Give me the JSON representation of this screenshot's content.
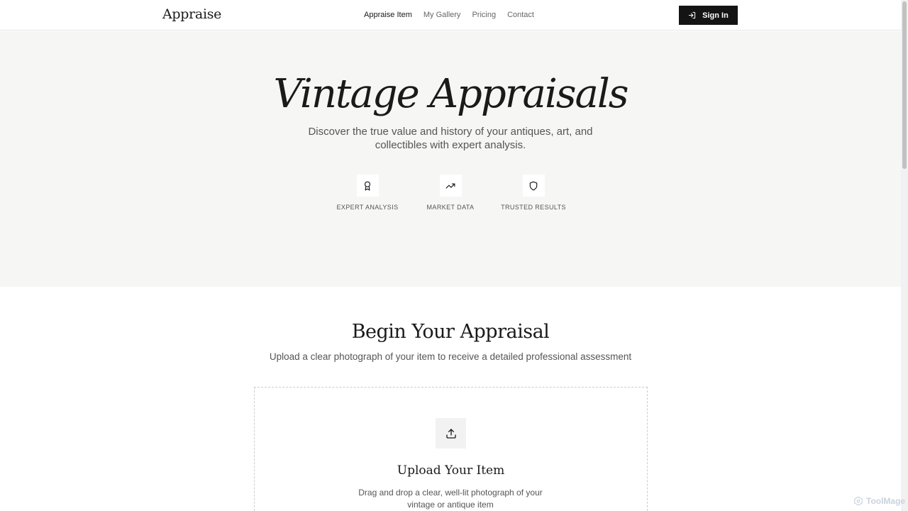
{
  "header": {
    "logo": "Appraise",
    "nav": [
      {
        "label": "Appraise Item",
        "active": true
      },
      {
        "label": "My Gallery",
        "active": false
      },
      {
        "label": "Pricing",
        "active": false
      },
      {
        "label": "Contact",
        "active": false
      }
    ],
    "sign_in_label": "Sign In",
    "sign_in_icon": "log-in-icon"
  },
  "hero": {
    "title": "Vintage Appraisals",
    "subtitle": "Discover the true value and history of your antiques, art, and collectibles with expert analysis.",
    "features": [
      {
        "icon": "award-icon",
        "label": "EXPERT ANALYSIS"
      },
      {
        "icon": "trending-up-icon",
        "label": "MARKET DATA"
      },
      {
        "icon": "shield-icon",
        "label": "TRUSTED RESULTS"
      }
    ]
  },
  "appraisal": {
    "title": "Begin Your Appraisal",
    "subtitle": "Upload a clear photograph of your item to receive a detailed professional assessment",
    "upload": {
      "icon": "upload-icon",
      "title": "Upload Your Item",
      "subtitle": "Drag and drop a clear, well-lit photograph of your vintage or antique item"
    }
  },
  "watermark": "ToolMage",
  "colors": {
    "hero_bg": "#f6f6f5",
    "button_bg": "#141414",
    "text": "#1a1a1a",
    "muted": "#555555"
  }
}
